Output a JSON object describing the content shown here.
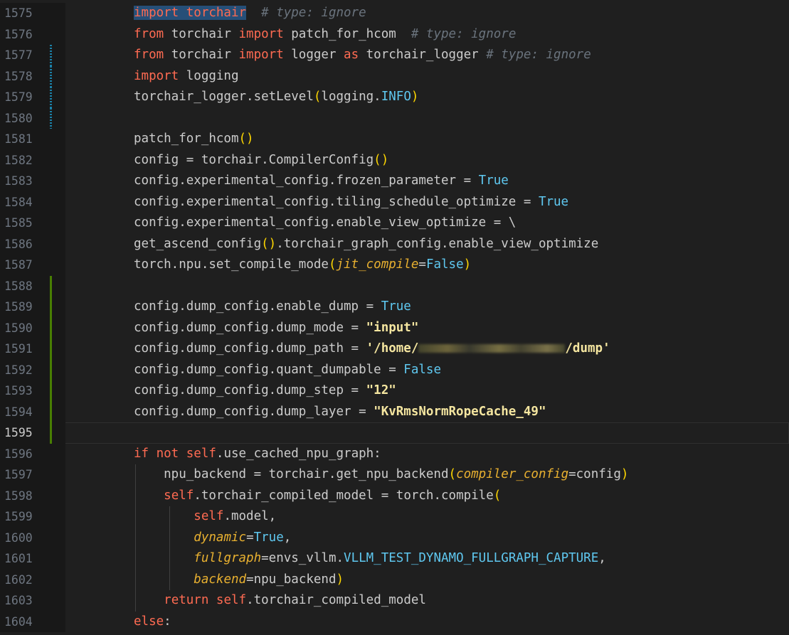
{
  "lines": [
    {
      "n": "1575",
      "parts": [
        {
          "t": "import torchair",
          "c": "kw sel"
        },
        {
          "t": "  "
        },
        {
          "t": "# type: ignore",
          "c": "cm"
        }
      ]
    },
    {
      "n": "1576",
      "parts": [
        {
          "t": "from",
          "c": "kw"
        },
        {
          "t": " torchair "
        },
        {
          "t": "import",
          "c": "kw"
        },
        {
          "t": " patch_for_hcom  "
        },
        {
          "t": "# type: ignore",
          "c": "cm"
        }
      ]
    },
    {
      "n": "1577",
      "mark": "mod",
      "parts": [
        {
          "t": "from",
          "c": "kw"
        },
        {
          "t": " torchair "
        },
        {
          "t": "import",
          "c": "kw"
        },
        {
          "t": " logger "
        },
        {
          "t": "as",
          "c": "kw"
        },
        {
          "t": " torchair_logger "
        },
        {
          "t": "# type: ignore",
          "c": "cm"
        }
      ]
    },
    {
      "n": "1578",
      "mark": "mod",
      "parts": [
        {
          "t": "import",
          "c": "kw"
        },
        {
          "t": " logging"
        }
      ]
    },
    {
      "n": "1579",
      "mark": "mod",
      "parts": [
        {
          "t": "torchair_logger.setLevel"
        },
        {
          "t": "(",
          "c": "pr"
        },
        {
          "t": "logging."
        },
        {
          "t": "INFO",
          "c": "cst"
        },
        {
          "t": ")",
          "c": "pr"
        }
      ]
    },
    {
      "n": "1580",
      "mark": "mod",
      "parts": []
    },
    {
      "n": "1581",
      "parts": [
        {
          "t": "patch_for_hcom"
        },
        {
          "t": "()",
          "c": "pr"
        }
      ]
    },
    {
      "n": "1582",
      "parts": [
        {
          "t": "config = torchair.CompilerConfig"
        },
        {
          "t": "()",
          "c": "pr"
        }
      ]
    },
    {
      "n": "1583",
      "parts": [
        {
          "t": "config.experimental_config.frozen_parameter = "
        },
        {
          "t": "True",
          "c": "cst"
        }
      ]
    },
    {
      "n": "1584",
      "parts": [
        {
          "t": "config.experimental_config.tiling_schedule_optimize = "
        },
        {
          "t": "True",
          "c": "cst"
        }
      ]
    },
    {
      "n": "1585",
      "parts": [
        {
          "t": "config.experimental_config.enable_view_optimize = \\"
        }
      ]
    },
    {
      "n": "1586",
      "parts": [
        {
          "t": "get_ascend_config"
        },
        {
          "t": "()",
          "c": "pr"
        },
        {
          "t": ".torchair_graph_config.enable_view_optimize"
        }
      ]
    },
    {
      "n": "1587",
      "parts": [
        {
          "t": "torch.npu.set_compile_mode"
        },
        {
          "t": "(",
          "c": "pr"
        },
        {
          "t": "jit_compile",
          "c": "pm"
        },
        {
          "t": "="
        },
        {
          "t": "False",
          "c": "cst"
        },
        {
          "t": ")",
          "c": "pr"
        }
      ]
    },
    {
      "n": "1588",
      "mark": "add",
      "parts": []
    },
    {
      "n": "1589",
      "mark": "add",
      "parts": [
        {
          "t": "config.dump_config.enable_dump = "
        },
        {
          "t": "True",
          "c": "cst"
        }
      ]
    },
    {
      "n": "1590",
      "mark": "add",
      "parts": [
        {
          "t": "config.dump_config.dump_mode = "
        },
        {
          "t": "\"input\"",
          "c": "str"
        }
      ]
    },
    {
      "n": "1591",
      "mark": "add",
      "parts": [
        {
          "t": "config.dump_config.dump_path = "
        },
        {
          "t": "'/home/",
          "c": "str"
        },
        {
          "blur": true
        },
        {
          "t": "/dump'",
          "c": "str"
        }
      ]
    },
    {
      "n": "1592",
      "mark": "add",
      "parts": [
        {
          "t": "config.dump_config.quant_dumpable = "
        },
        {
          "t": "False",
          "c": "cst"
        }
      ]
    },
    {
      "n": "1593",
      "mark": "add",
      "parts": [
        {
          "t": "config.dump_config.dump_step = "
        },
        {
          "t": "\"12\"",
          "c": "str"
        }
      ]
    },
    {
      "n": "1594",
      "mark": "add",
      "parts": [
        {
          "t": "config.dump_config.dump_layer = "
        },
        {
          "t": "\"KvRmsNormRopeCache_49\"",
          "c": "str"
        }
      ]
    },
    {
      "n": "1595",
      "mark": "add",
      "current": true,
      "parts": []
    },
    {
      "n": "1596",
      "parts": [
        {
          "t": "if not",
          "c": "kw"
        },
        {
          "t": " "
        },
        {
          "t": "self",
          "c": "kw"
        },
        {
          "t": ".use_cached_npu_graph:"
        }
      ]
    },
    {
      "n": "1597",
      "guides": [
        190
      ],
      "parts": [
        {
          "t": "    npu_backend = torchair.get_npu_backend"
        },
        {
          "t": "(",
          "c": "pr"
        },
        {
          "t": "compiler_config",
          "c": "pm"
        },
        {
          "t": "=config"
        },
        {
          "t": ")",
          "c": "pr"
        }
      ]
    },
    {
      "n": "1598",
      "guides": [
        190
      ],
      "parts": [
        {
          "t": "    "
        },
        {
          "t": "self",
          "c": "kw"
        },
        {
          "t": ".torchair_compiled_model = torch.compile"
        },
        {
          "t": "(",
          "c": "pr"
        }
      ]
    },
    {
      "n": "1599",
      "guides": [
        190,
        238
      ],
      "parts": [
        {
          "t": "        "
        },
        {
          "t": "self",
          "c": "kw"
        },
        {
          "t": ".model,"
        }
      ]
    },
    {
      "n": "1600",
      "guides": [
        190,
        238
      ],
      "parts": [
        {
          "t": "        "
        },
        {
          "t": "dynamic",
          "c": "pm"
        },
        {
          "t": "="
        },
        {
          "t": "True",
          "c": "cst"
        },
        {
          "t": ","
        }
      ]
    },
    {
      "n": "1601",
      "guides": [
        190,
        238
      ],
      "parts": [
        {
          "t": "        "
        },
        {
          "t": "fullgraph",
          "c": "pm"
        },
        {
          "t": "=envs_vllm."
        },
        {
          "t": "VLLM_TEST_DYNAMO_FULLGRAPH_CAPTURE",
          "c": "cst"
        },
        {
          "t": ","
        }
      ]
    },
    {
      "n": "1602",
      "guides": [
        190,
        238
      ],
      "parts": [
        {
          "t": "        "
        },
        {
          "t": "backend",
          "c": "pm"
        },
        {
          "t": "=npu_backend"
        },
        {
          "t": ")",
          "c": "pr"
        }
      ]
    },
    {
      "n": "1603",
      "guides": [
        190
      ],
      "parts": [
        {
          "t": "    "
        },
        {
          "t": "return",
          "c": "kw"
        },
        {
          "t": " "
        },
        {
          "t": "self",
          "c": "kw"
        },
        {
          "t": ".torchair_compiled_model"
        }
      ]
    },
    {
      "n": "1604",
      "parts": [
        {
          "t": "else",
          "c": "kw"
        },
        {
          "t": ":"
        }
      ]
    }
  ]
}
